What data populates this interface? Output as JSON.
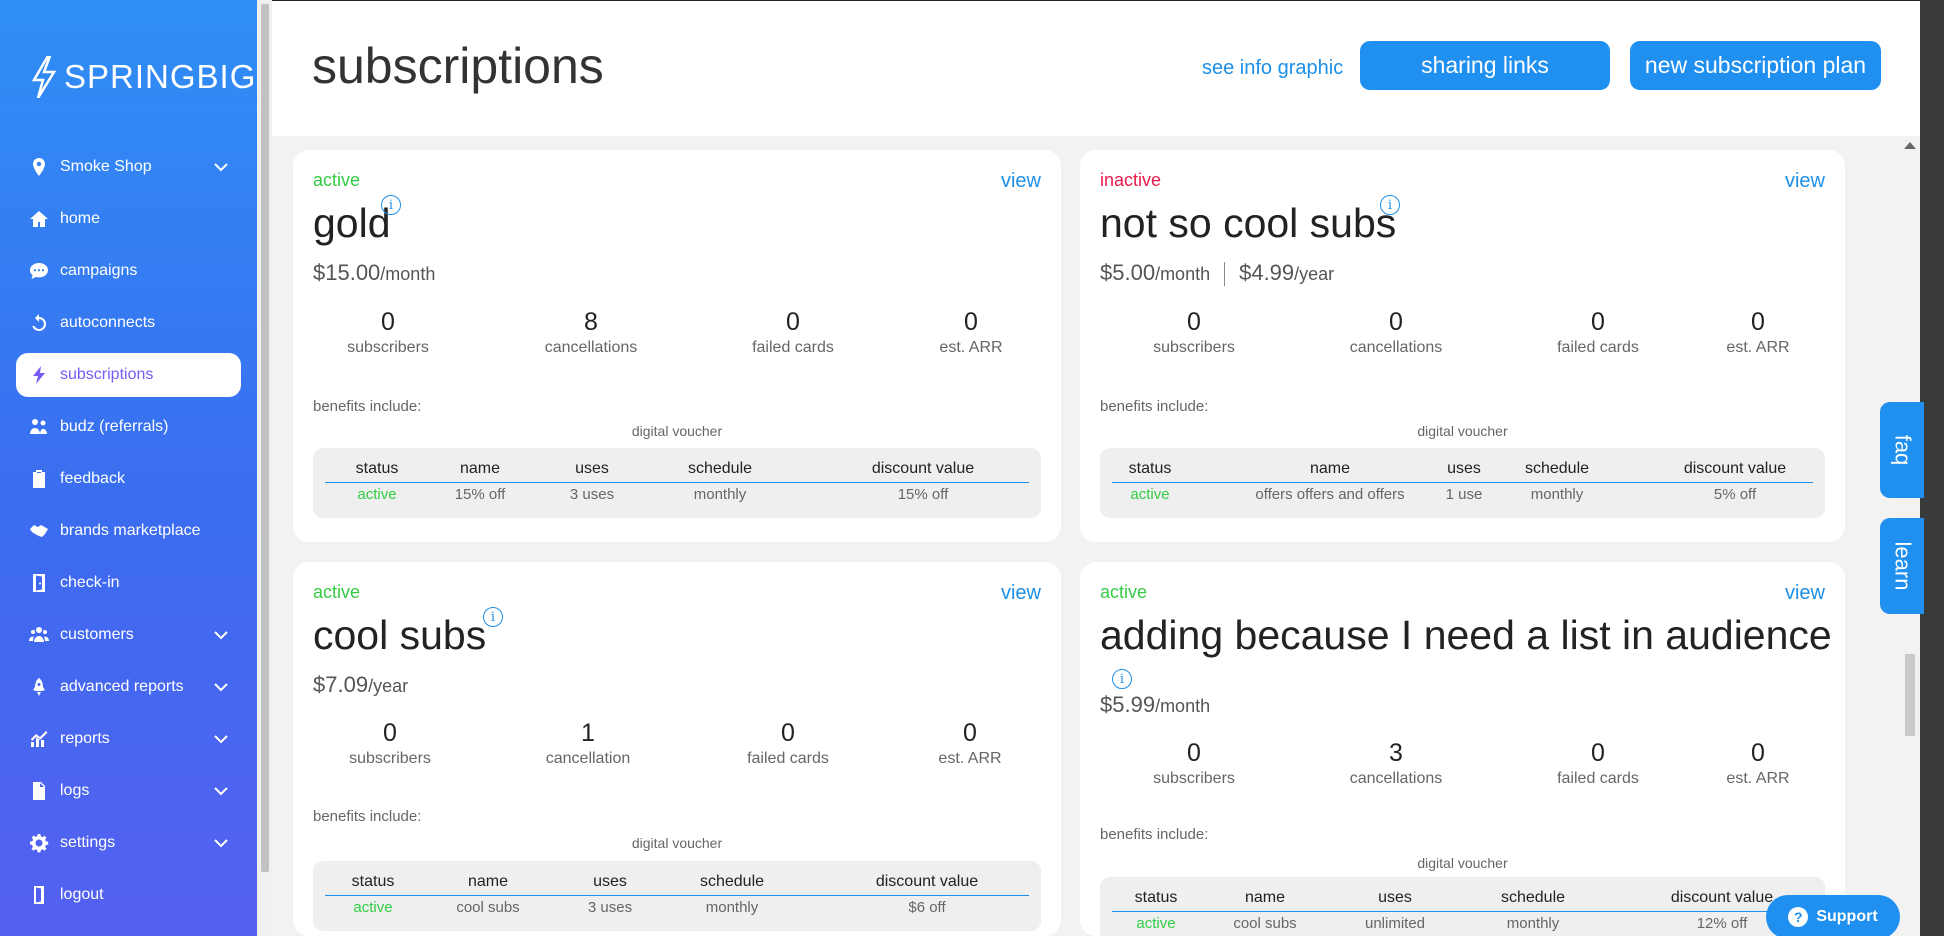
{
  "brand": {
    "logo_text": "SPRINGBIG"
  },
  "sidebar": {
    "items": [
      {
        "label": "Smoke Shop",
        "icon": "location-pin-icon",
        "has_chevron": true
      },
      {
        "label": "home",
        "icon": "home-icon"
      },
      {
        "label": "campaigns",
        "icon": "chat-bubble-icon"
      },
      {
        "label": "autoconnects",
        "icon": "refresh-icon"
      },
      {
        "label": "subscriptions",
        "icon": "bolt-icon",
        "active": true
      },
      {
        "label": "budz (referrals)",
        "icon": "people-icon"
      },
      {
        "label": "feedback",
        "icon": "clipboard-icon"
      },
      {
        "label": "brands marketplace",
        "icon": "handshake-icon"
      },
      {
        "label": "check-in",
        "icon": "door-icon"
      },
      {
        "label": "customers",
        "icon": "users-icon",
        "has_chevron": true
      },
      {
        "label": "advanced reports",
        "icon": "rocket-icon",
        "has_chevron": true
      },
      {
        "label": "reports",
        "icon": "chart-icon",
        "has_chevron": true
      },
      {
        "label": "logs",
        "icon": "file-icon",
        "has_chevron": true
      },
      {
        "label": "settings",
        "icon": "gear-icon",
        "has_chevron": true
      },
      {
        "label": "logout",
        "icon": "logout-icon"
      }
    ]
  },
  "header": {
    "title": "subscriptions",
    "info_link": "see info graphic",
    "sharing_button": "sharing links",
    "new_plan_button": "new subscription plan"
  },
  "side_tabs": {
    "faq": "faq",
    "learn": "learn"
  },
  "support": {
    "label": "Support"
  },
  "table_headers": [
    "status",
    "name",
    "uses",
    "schedule",
    "discount value"
  ],
  "plans": [
    {
      "status": "active",
      "view": "view",
      "name": "gold",
      "price_1": "$15.00",
      "period_1": "/month",
      "stats": [
        {
          "value": "0",
          "label": "subscribers"
        },
        {
          "value": "8",
          "label": "cancellations"
        },
        {
          "value": "0",
          "label": "failed cards"
        },
        {
          "value": "0",
          "label": "est. ARR"
        }
      ],
      "benefits_label": "benefits include:",
      "benefit_type": "digital voucher",
      "row": {
        "status": "active",
        "name": "15% off",
        "uses": "3 uses",
        "schedule": "monthly",
        "discount": "15% off"
      }
    },
    {
      "status": "inactive",
      "view": "view",
      "name": "not so cool subs",
      "price_1": "$5.00",
      "period_1": "/month",
      "price_2": "$4.99",
      "period_2": "/year",
      "stats": [
        {
          "value": "0",
          "label": "subscribers"
        },
        {
          "value": "0",
          "label": "cancellations"
        },
        {
          "value": "0",
          "label": "failed cards"
        },
        {
          "value": "0",
          "label": "est. ARR"
        }
      ],
      "benefits_label": "benefits include:",
      "benefit_type": "digital voucher",
      "row": {
        "status": "active",
        "name": "offers offers and offers",
        "uses": "1 use",
        "schedule": "monthly",
        "discount": "5% off"
      }
    },
    {
      "status": "active",
      "view": "view",
      "name": "cool subs",
      "price_1": "$7.09",
      "period_1": "/year",
      "stats": [
        {
          "value": "0",
          "label": "subscribers"
        },
        {
          "value": "1",
          "label": "cancellation"
        },
        {
          "value": "0",
          "label": "failed cards"
        },
        {
          "value": "0",
          "label": "est. ARR"
        }
      ],
      "benefits_label": "benefits include:",
      "benefit_type": "digital voucher",
      "row": {
        "status": "active",
        "name": "cool subs",
        "uses": "3 uses",
        "schedule": "monthly",
        "discount": "$6 off"
      }
    },
    {
      "status": "active",
      "view": "view",
      "name": "adding because I need a list in audience",
      "price_1": "$5.99",
      "period_1": "/month",
      "stats": [
        {
          "value": "0",
          "label": "subscribers"
        },
        {
          "value": "3",
          "label": "cancellations"
        },
        {
          "value": "0",
          "label": "failed cards"
        },
        {
          "value": "0",
          "label": "est. ARR"
        }
      ],
      "benefits_label": "benefits include:",
      "benefit_type": "digital voucher",
      "row": {
        "status": "active",
        "name": "cool subs",
        "uses": "unlimited",
        "schedule": "monthly",
        "discount": "12% off"
      }
    }
  ],
  "colors": {
    "accent": "#1f8ff0",
    "active": "#33cc44",
    "inactive": "#ea1a4a",
    "sidebar_active_text": "#7a5af5"
  }
}
